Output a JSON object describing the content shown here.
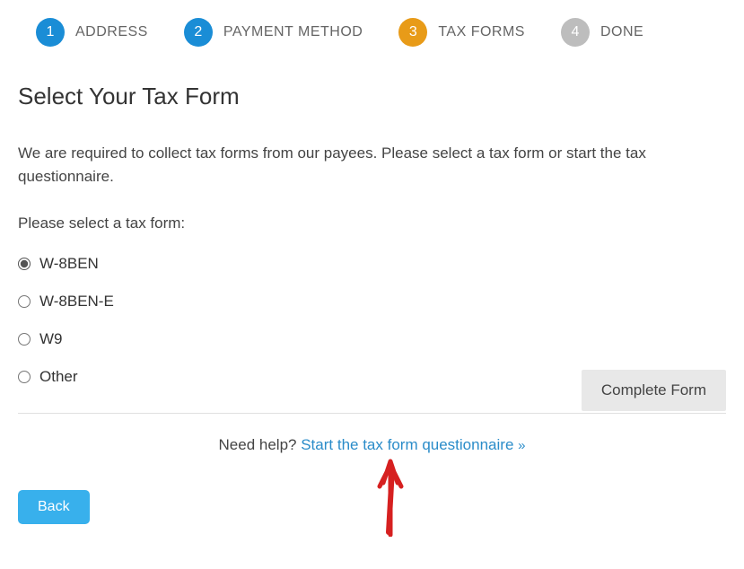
{
  "steps": [
    {
      "num": "1",
      "label": "ADDRESS",
      "state": "done"
    },
    {
      "num": "2",
      "label": "PAYMENT METHOD",
      "state": "done"
    },
    {
      "num": "3",
      "label": "TAX FORMS",
      "state": "active"
    },
    {
      "num": "4",
      "label": "DONE",
      "state": "pending"
    }
  ],
  "page_title": "Select Your Tax Form",
  "description": "We are required to collect tax forms from our payees. Please select a tax form or start the tax questionnaire.",
  "form_label": "Please select a tax form:",
  "options": [
    {
      "value": "w8ben",
      "label": "W-8BEN",
      "selected": true
    },
    {
      "value": "w8bene",
      "label": "W-8BEN-E",
      "selected": false
    },
    {
      "value": "w9",
      "label": "W9",
      "selected": false
    },
    {
      "value": "other",
      "label": "Other",
      "selected": false
    }
  ],
  "complete_button": "Complete Form",
  "help_prefix": "Need help? ",
  "help_link": "Start the tax form questionnaire ",
  "back_button": "Back"
}
